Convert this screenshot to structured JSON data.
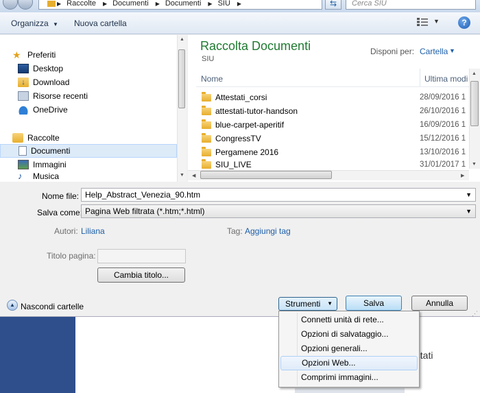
{
  "address": {
    "segments": [
      "Raccolte",
      "Documenti",
      "Documenti",
      "SIU"
    ],
    "search_placeholder": "Cerca SIU"
  },
  "toolbar": {
    "organize": "Organizza",
    "new_folder": "Nuova cartella",
    "help": "?"
  },
  "nav": {
    "favorites_label": "Preferiti",
    "favorites": [
      "Desktop",
      "Download",
      "Risorse recenti",
      "OneDrive"
    ],
    "libraries_label": "Raccolte",
    "libraries": [
      "Documenti",
      "Immagini",
      "Musica"
    ]
  },
  "content": {
    "title": "Raccolta Documenti",
    "subtitle": "SIU",
    "arrange_label": "Disponi per:",
    "arrange_value": "Cartella",
    "col_name": "Nome",
    "col_date": "Ultima modi",
    "files": [
      {
        "name": "Attestati_corsi",
        "date": "28/09/2016 1"
      },
      {
        "name": "attestati-tutor-handson",
        "date": "26/10/2016 1"
      },
      {
        "name": "blue-carpet-aperitif",
        "date": "16/09/2016 1"
      },
      {
        "name": "CongressTV",
        "date": "15/12/2016 1"
      },
      {
        "name": "Pergamene 2016",
        "date": "13/10/2016 1"
      },
      {
        "name": "SIU_LIVE",
        "date": "31/01/2017 1"
      }
    ]
  },
  "form": {
    "filename_label": "Nome file:",
    "filename_value": "Help_Abstract_Venezia_90.htm",
    "savetype_label": "Salva come:",
    "savetype_value": "Pagina Web filtrata (*.htm;*.html)",
    "authors_label": "Autori:",
    "authors_value": "Liliana",
    "tags_label": "Tag:",
    "tags_value": "Aggiungi tag",
    "page_title_label": "Titolo pagina:",
    "change_title_button": "Cambia titolo..."
  },
  "bottom": {
    "hide_folders": "Nascondi cartelle",
    "tools": "Strumenti",
    "save": "Salva",
    "cancel": "Annulla"
  },
  "menu": {
    "items": [
      "Connetti unità di rete...",
      "Opzioni di salvataggio...",
      "Opzioni generali...",
      "Opzioni Web...",
      "Comprimi immagini..."
    ],
    "hovered_index": 3
  },
  "background": {
    "text": "estati"
  },
  "colors": {
    "library_title": "#1e7a30",
    "link": "#1e5fa8",
    "selection": "#ddeaf8"
  }
}
